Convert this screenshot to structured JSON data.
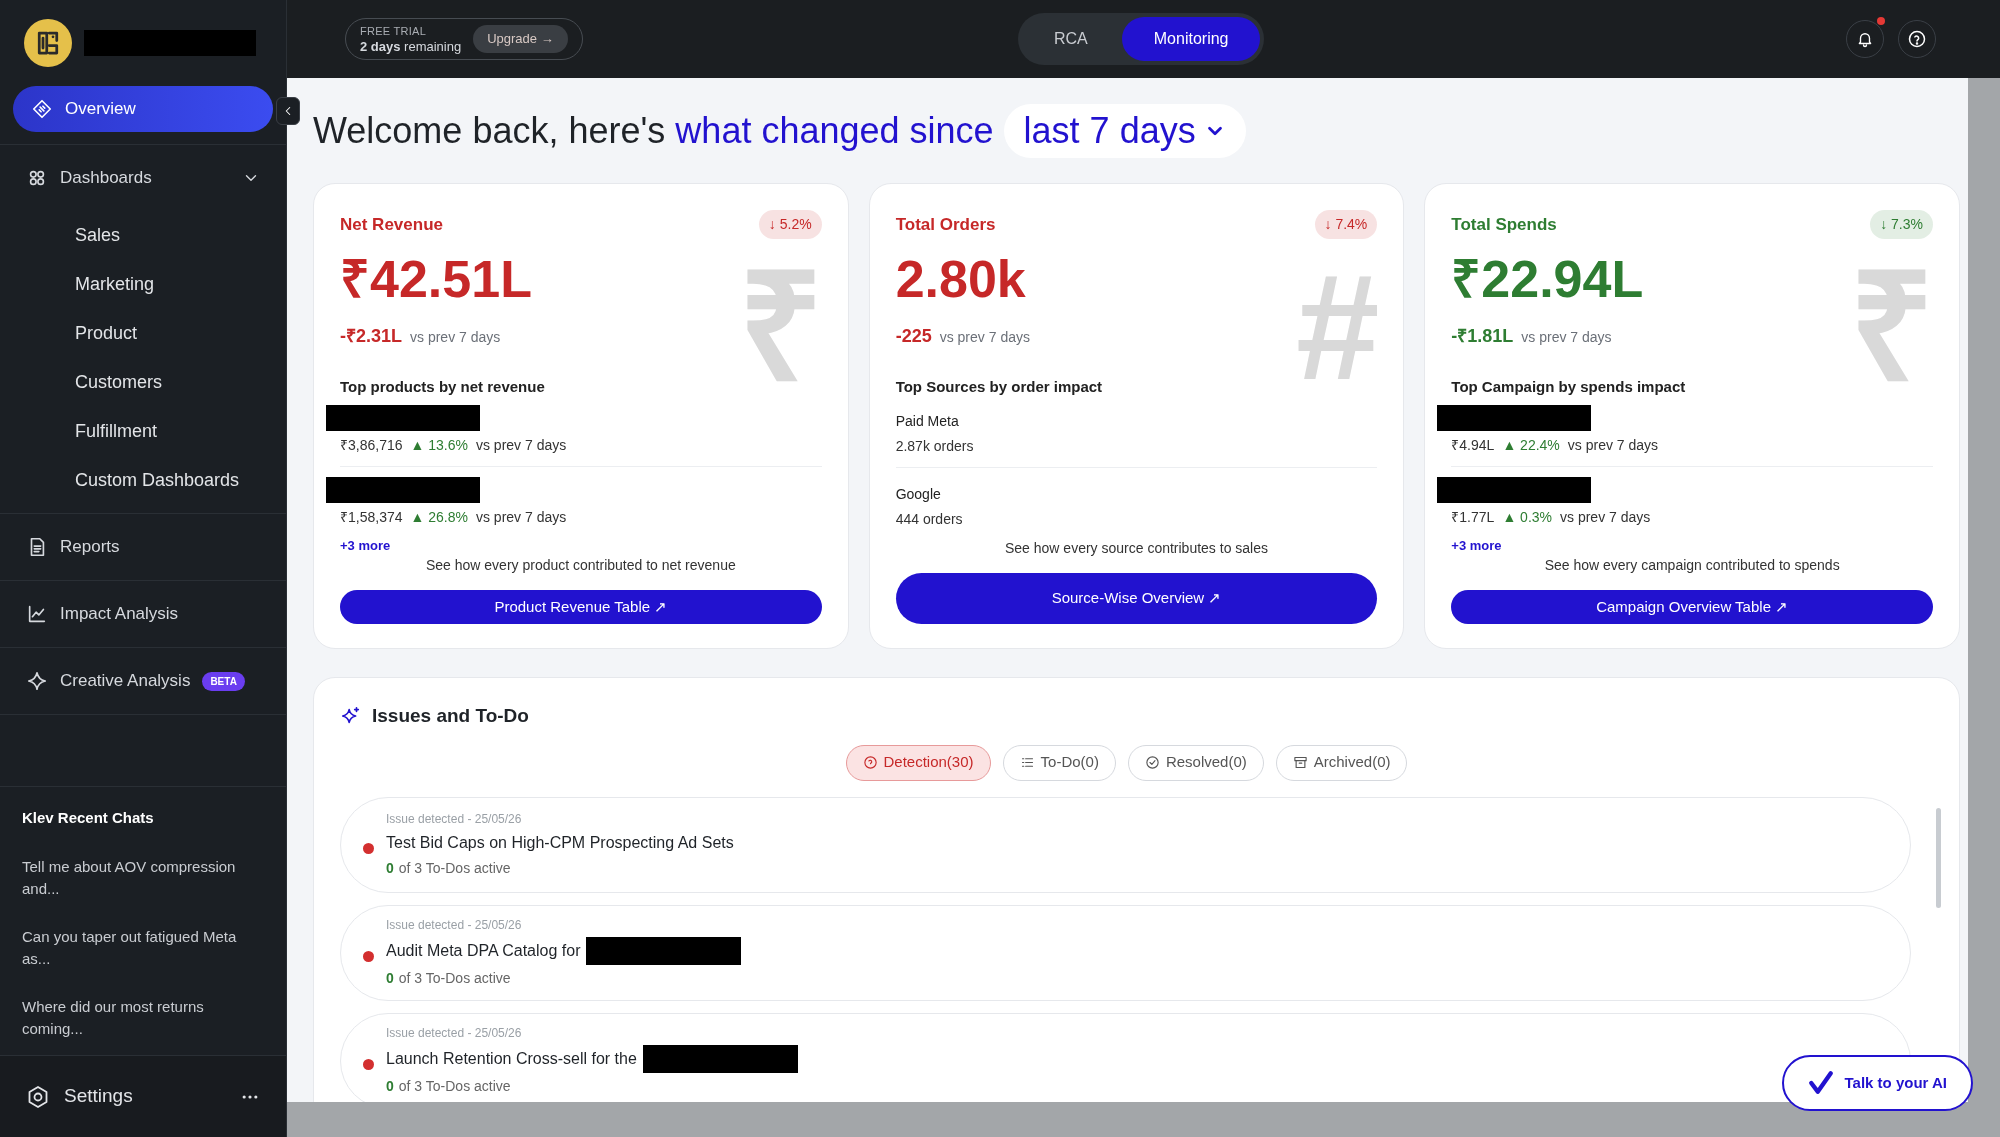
{
  "header": {
    "trial_label": "FREE TRIAL",
    "trial_text": "**2 days** remaining",
    "upgrade": "Upgrade →",
    "mode_tabs": [
      {
        "label": "RCA",
        "selected": false
      },
      {
        "label": "Monitoring",
        "selected": true
      }
    ],
    "notifications_unread": true
  },
  "sidebar": {
    "brand_redacted": true,
    "items": [
      {
        "label": "Overview",
        "selected": true
      },
      {
        "label": "Dashboards",
        "selected": false,
        "expanded": true,
        "children": [
          {
            "label": "Sales"
          },
          {
            "label": "Marketing"
          },
          {
            "label": "Product"
          },
          {
            "label": "Customers"
          },
          {
            "label": "Fulfillment"
          },
          {
            "label": "Custom Dashboards"
          }
        ]
      },
      {
        "label": "Reports",
        "selected": false
      },
      {
        "label": "Impact Analysis",
        "selected": false
      },
      {
        "label": "Creative Analysis",
        "selected": false,
        "badge": "BETA"
      }
    ],
    "recent_chats": {
      "title": "Klev Recent Chats",
      "chats": [
        "Tell me about AOV compression and...",
        "Can you taper out fatigued Meta as...",
        "Where did our most returns coming..."
      ]
    },
    "settings": "Settings"
  },
  "heading": {
    "text": "Welcome back, here's ",
    "highlight": "what changed since",
    "period": "last 7 days"
  },
  "cards": [
    {
      "title": "Net Revenue",
      "color": "#c62828",
      "change": "↓ 5.2%",
      "glyph": "₹",
      "value": "₹42.51L",
      "delta": "-₹2.31L",
      "delta_note": "vs prev 7 days",
      "section_title": "Top products by net revenue",
      "entries": [
        {
          "kind": "metric",
          "redacted": true,
          "amount": "₹3,86,716",
          "change": "▲ 13.6%",
          "note": "vs prev 7 days"
        },
        {
          "kind": "metric",
          "redacted": true,
          "amount": "₹1,58,374",
          "change": "▲ 26.8%",
          "note": "vs prev 7 days"
        }
      ],
      "more": "+3 more",
      "footer": "See how every product contributed to net revenue",
      "button": "Product Revenue Table ↗"
    },
    {
      "title": "Total Orders",
      "color": "#c62828",
      "change": "↓ 7.4%",
      "glyph": "#",
      "value": "2.80k",
      "delta": "-225",
      "delta_note": "vs prev 7 days",
      "section_title": "Top Sources by order impact",
      "entries": [
        {
          "kind": "source",
          "name": "Paid Meta",
          "amount": "2.87k orders"
        },
        {
          "kind": "source",
          "name": "Google",
          "amount": "444 orders"
        }
      ],
      "footer": "See how every source contributes to sales",
      "button": "Source-Wise Overview ↗"
    },
    {
      "title": "Total Spends",
      "color": "#2e7d32",
      "change": "↓ 7.3%",
      "glyph": "₹",
      "value": "₹22.94L",
      "delta": "-₹1.81L",
      "delta_note": "vs prev 7 days",
      "section_title": "Top Campaign by spends impact",
      "entries": [
        {
          "kind": "metric",
          "redacted": true,
          "amount": "₹4.94L",
          "change": "▲ 22.4%",
          "note": "vs prev 7 days"
        },
        {
          "kind": "metric",
          "redacted": true,
          "amount": "₹1.77L",
          "change": "▲ 0.3%",
          "note": "vs prev 7 days"
        }
      ],
      "more": "+3 more",
      "footer": "See how every campaign contributed to spends",
      "button": "Campaign Overview Table ↗"
    }
  ],
  "issues": {
    "title": "Issues and To-Do",
    "filters": [
      {
        "label": "Detection(30)",
        "selected": true
      },
      {
        "label": "To-Do(0)",
        "selected": false
      },
      {
        "label": "Resolved(0)",
        "selected": false
      },
      {
        "label": "Archived(0)",
        "selected": false
      }
    ],
    "items": [
      {
        "meta": "Issue detected - 25/05/26",
        "title": "Test Bid Caps on High-CPM Prospecting Ad Sets",
        "redacted": false,
        "color": "#d32f2f",
        "active_count": "0",
        "todo_note": "of 3 To-Dos active"
      },
      {
        "meta": "Issue detected - 25/05/26",
        "title": "Audit Meta DPA Catalog for",
        "redacted": true,
        "color": "#d32f2f",
        "active_count": "0",
        "todo_note": "of 3 To-Dos active"
      },
      {
        "meta": "Issue detected - 25/05/26",
        "title": "Launch Retention Cross-sell for the",
        "redacted": true,
        "color": "#d32f2f",
        "active_count": "0",
        "todo_note": "of 3 To-Dos active"
      }
    ]
  },
  "assistant_button": "Talk to your AI"
}
